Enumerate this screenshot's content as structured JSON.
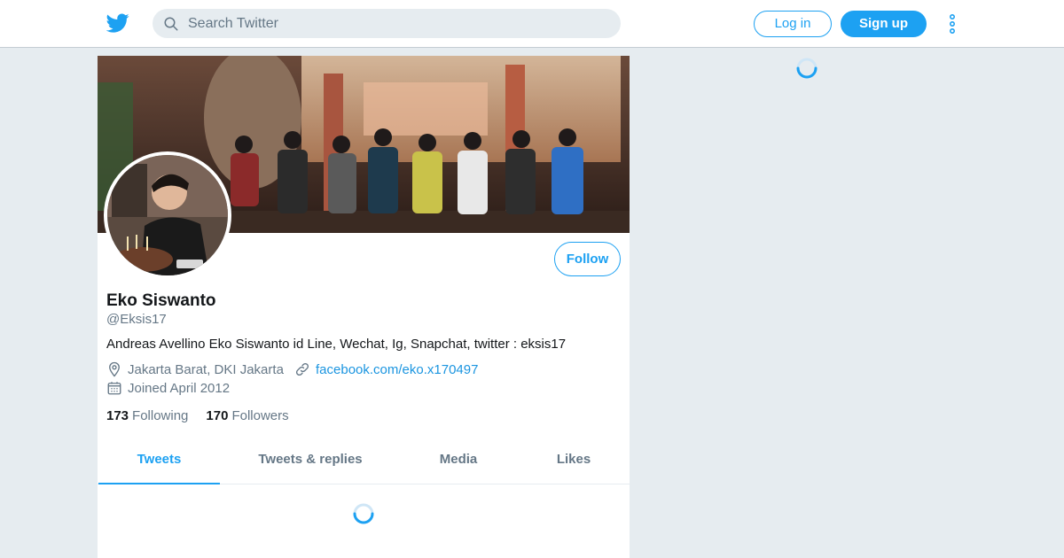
{
  "header": {
    "search": {
      "placeholder": "Search Twitter"
    },
    "login_label": "Log in",
    "signup_label": "Sign up"
  },
  "profile": {
    "name": "Eko Siswanto",
    "handle": "@Eksis17",
    "bio": "Andreas Avellino Eko Siswanto id Line, Wechat, Ig, Snapchat, twitter : eksis17",
    "location": "Jakarta Barat, DKI Jakarta",
    "website": "facebook.com/eko.x170497",
    "joined": "Joined April 2012",
    "follow_label": "Follow",
    "following_count": "173",
    "following_label": "Following",
    "followers_count": "170",
    "followers_label": "Followers"
  },
  "tabs": [
    {
      "label": "Tweets",
      "active": true
    },
    {
      "label": "Tweets & replies",
      "active": false
    },
    {
      "label": "Media",
      "active": false
    },
    {
      "label": "Likes",
      "active": false
    }
  ],
  "colors": {
    "accent": "#1da1f2",
    "link": "#1b95e0",
    "background": "#e6ecf0",
    "secondary_text": "#657786"
  },
  "icons": [
    "twitter-logo-icon",
    "search-icon",
    "more-vertical-icon",
    "location-icon",
    "link-icon",
    "calendar-icon",
    "loading-spinner-icon"
  ]
}
